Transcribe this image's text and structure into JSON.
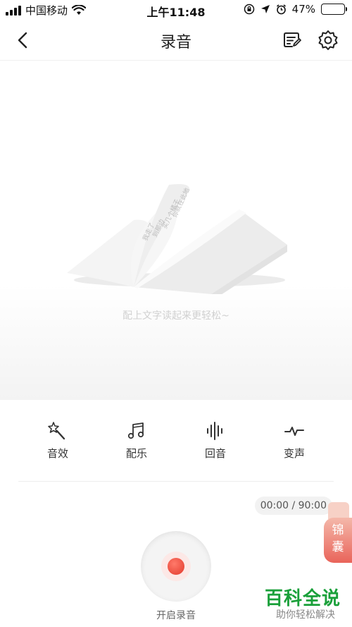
{
  "status_bar": {
    "carrier": "中国移动",
    "time": "上午11:48",
    "battery": "47%",
    "battery_level": 0.47
  },
  "nav": {
    "title": "录音",
    "back_icon": "chevron-left-icon",
    "edit_icon": "text-edit-icon",
    "settings_icon": "gear-icon"
  },
  "preview": {
    "hint": "配上文字读起来更轻松~",
    "book_lines": [
      "我走了",
      "到那边",
      "买几个橘子",
      "你就在此地"
    ]
  },
  "tools": [
    {
      "label": "音效",
      "icon": "magic-wand-icon"
    },
    {
      "label": "配乐",
      "icon": "music-note-icon"
    },
    {
      "label": "回音",
      "icon": "soundwave-icon"
    },
    {
      "label": "变声",
      "icon": "pulse-icon"
    }
  ],
  "timer": "00:00 / 90:00",
  "record": {
    "label": "开启录音",
    "accent": "#e2392c"
  },
  "side_tag": {
    "line1": "锦",
    "line2": "囊"
  },
  "watermark": {
    "title": "百科全说",
    "subtitle": "助你轻松解决",
    "color": "#1aa03a"
  }
}
